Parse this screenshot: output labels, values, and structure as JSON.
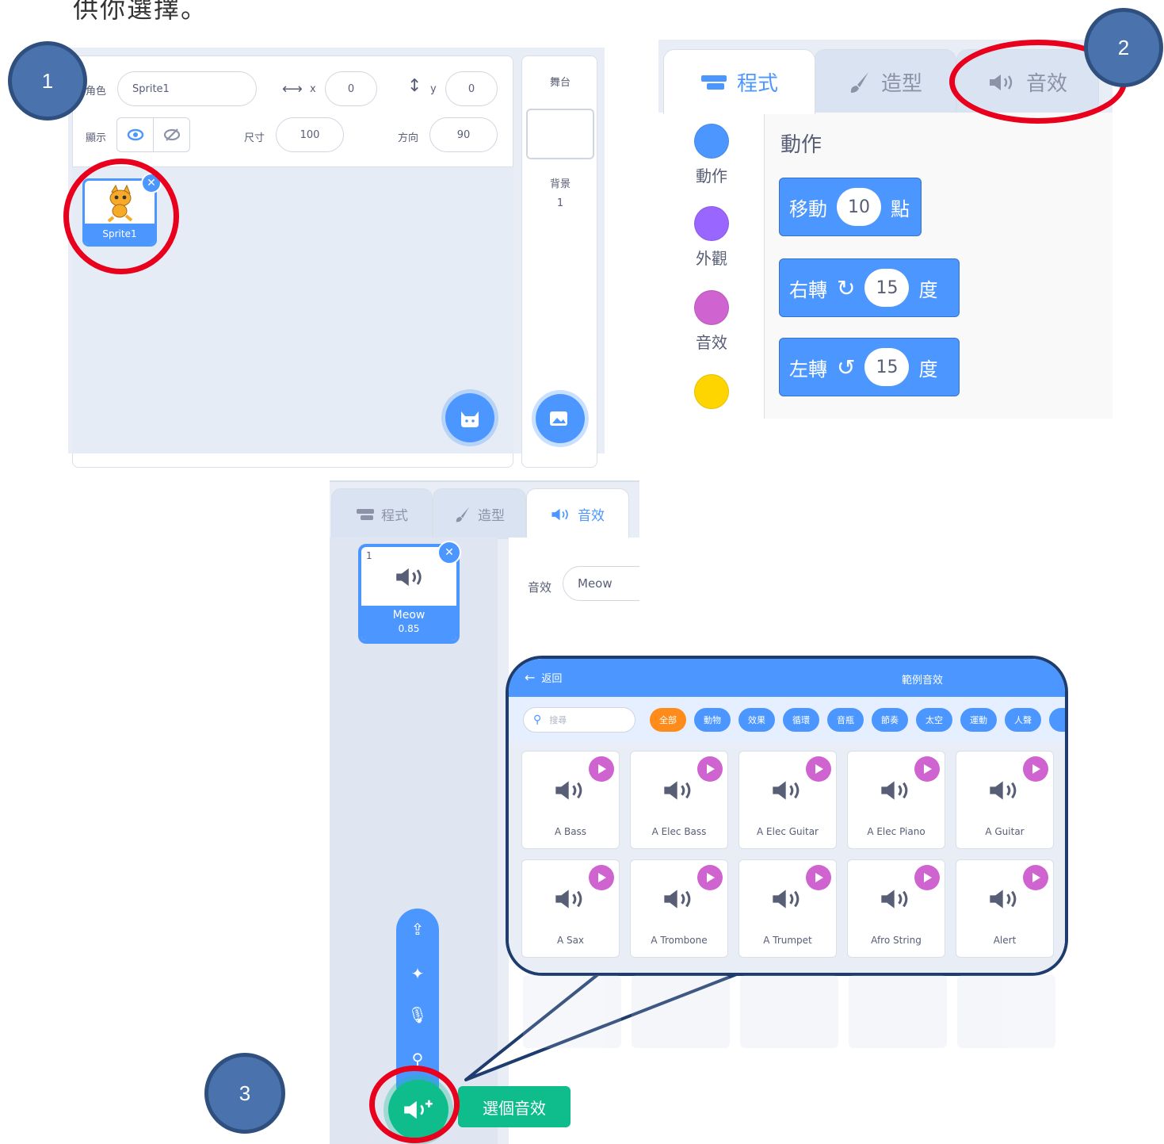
{
  "intro_text": "供你選擇。",
  "markers": [
    "1",
    "2",
    "3"
  ],
  "sprite_info": {
    "sprite_label": "角色",
    "sprite_name": "Sprite1",
    "x_label": "x",
    "x_value": "0",
    "y_label": "y",
    "y_value": "0",
    "show_label": "顯示",
    "size_label": "尺寸",
    "size_value": "100",
    "direction_label": "方向",
    "direction_value": "90",
    "stage_label": "舞台",
    "backdrop_label": "背景",
    "backdrop_count": "1",
    "thumb_name": "Sprite1"
  },
  "blocks_panel": {
    "tabs": [
      {
        "label": "程式",
        "icon": "code-icon"
      },
      {
        "label": "造型",
        "icon": "brush-icon"
      },
      {
        "label": "音效",
        "icon": "speaker-icon"
      }
    ],
    "categories": [
      {
        "label": "動作",
        "color": "#4c97ff"
      },
      {
        "label": "外觀",
        "color": "#9966ff"
      },
      {
        "label": "音效",
        "color": "#cf63cf"
      },
      {
        "label": "",
        "color": "#ffd500"
      }
    ],
    "heading": "動作",
    "blocks": [
      {
        "pre": "移動",
        "value": "10",
        "post": "點"
      },
      {
        "pre": "右轉",
        "value": "15",
        "post": "度",
        "icon": "rotate-right-icon"
      },
      {
        "pre": "左轉",
        "value": "15",
        "post": "度",
        "icon": "rotate-left-icon"
      }
    ]
  },
  "sound_editor": {
    "tabs": [
      "程式",
      "造型",
      "音效"
    ],
    "item_index": "1",
    "item_name": "Meow",
    "item_duration": "0.85",
    "sound_label": "音效",
    "sound_name": "Meow",
    "choose_label": "選個音效"
  },
  "library": {
    "back_label": "返回",
    "title": "範例音效",
    "search_placeholder": "搜尋",
    "filters": [
      "全部",
      "動物",
      "效果",
      "循環",
      "音瓶",
      "節奏",
      "太空",
      "運動",
      "人聲"
    ],
    "sounds": [
      "A Bass",
      "A Elec Bass",
      "A Elec Guitar",
      "A Elec Piano",
      "A Guitar",
      "A Sax",
      "A Trombone",
      "A Trumpet",
      "Afro String",
      "Alert"
    ]
  },
  "colors": {
    "motion": "#4c97ff",
    "looks": "#9966ff",
    "sound": "#cf63cf",
    "events": "#ffd500",
    "extension_green": "#0fbd8c",
    "highlight_red": "#e8001c",
    "marker_blue": "#4a72ad"
  }
}
